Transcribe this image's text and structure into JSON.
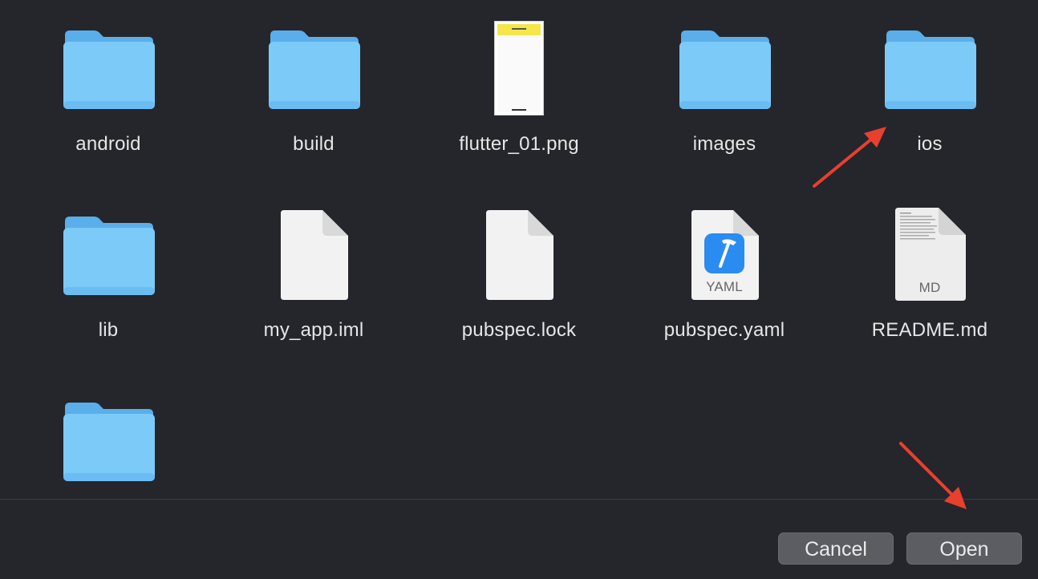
{
  "files": [
    {
      "name": "android",
      "kind": "folder",
      "icon": "folder-icon"
    },
    {
      "name": "build",
      "kind": "folder",
      "icon": "folder-icon"
    },
    {
      "name": "flutter_01.png",
      "kind": "image",
      "icon": "image-thumbnail-icon"
    },
    {
      "name": "images",
      "kind": "folder",
      "icon": "folder-icon"
    },
    {
      "name": "ios",
      "kind": "folder",
      "icon": "folder-icon"
    },
    {
      "name": "lib",
      "kind": "folder",
      "icon": "folder-icon"
    },
    {
      "name": "my_app.iml",
      "kind": "document",
      "icon": "document-icon"
    },
    {
      "name": "pubspec.lock",
      "kind": "document",
      "icon": "document-icon"
    },
    {
      "name": "pubspec.yaml",
      "kind": "yaml",
      "icon": "yaml-document-icon",
      "badge": "YAML"
    },
    {
      "name": "README.md",
      "kind": "markdown",
      "icon": "markdown-document-icon",
      "badge": "MD"
    },
    {
      "name": "",
      "kind": "folder",
      "icon": "folder-icon"
    }
  ],
  "footer": {
    "cancel_label": "Cancel",
    "open_label": "Open"
  },
  "colors": {
    "background": "#24262b",
    "folder_light": "#7ccaf8",
    "folder_dark": "#5aaee9",
    "button": "#5b5d62",
    "annotation_arrow": "#e8402e"
  }
}
